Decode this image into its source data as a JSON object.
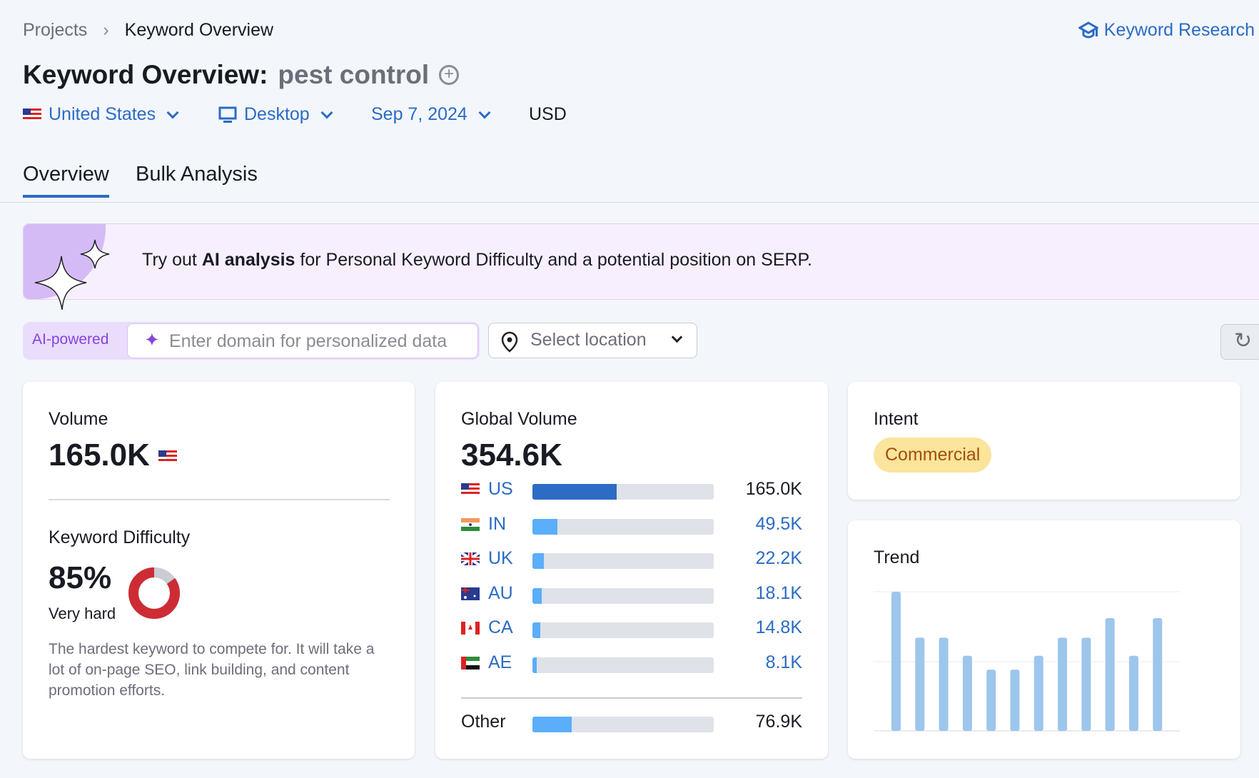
{
  "breadcrumb": [
    "Projects",
    "Keyword Overview"
  ],
  "header_link": "Keyword Research",
  "title": {
    "label": "Keyword Overview:",
    "keyword": "pest control"
  },
  "filters": {
    "country": "United States",
    "device": "Desktop",
    "date": "Sep 7, 2024",
    "currency": "USD"
  },
  "tabs": [
    {
      "label": "Overview",
      "active": true
    },
    {
      "label": "Bulk Analysis",
      "active": false
    }
  ],
  "banner": {
    "pre": "Try out ",
    "bold": "AI analysis",
    "post": " for Personal Keyword Difficulty and a potential position on SERP."
  },
  "ai": {
    "label": "AI-powered",
    "placeholder": "Enter domain for personalized data",
    "location_placeholder": "Select location"
  },
  "volume": {
    "label": "Volume",
    "value": "165.0K"
  },
  "difficulty": {
    "label": "Keyword Difficulty",
    "value": "85%",
    "percent": 85,
    "level": "Very hard",
    "description": "The hardest keyword to compete for. It will take a lot of on-page SEO, link building, and content promotion efforts.",
    "color": "#cd2c34"
  },
  "global": {
    "label": "Global Volume",
    "value": "354.6K",
    "total": 354.6,
    "rows": [
      {
        "code": "US",
        "value": "165.0K",
        "num": 165.0
      },
      {
        "code": "IN",
        "value": "49.5K",
        "num": 49.5
      },
      {
        "code": "UK",
        "value": "22.2K",
        "num": 22.2
      },
      {
        "code": "AU",
        "value": "18.1K",
        "num": 18.1
      },
      {
        "code": "CA",
        "value": "14.8K",
        "num": 14.8
      },
      {
        "code": "AE",
        "value": "8.1K",
        "num": 8.1
      }
    ],
    "other": {
      "label": "Other",
      "value": "76.9K",
      "num": 76.9
    }
  },
  "intent": {
    "label": "Intent",
    "value": "Commercial"
  },
  "trend": {
    "label": "Trend",
    "relative": [
      100,
      67,
      67,
      54,
      44,
      44,
      54,
      67,
      67,
      81,
      54,
      81
    ],
    "color": "#9dc6ec"
  }
}
